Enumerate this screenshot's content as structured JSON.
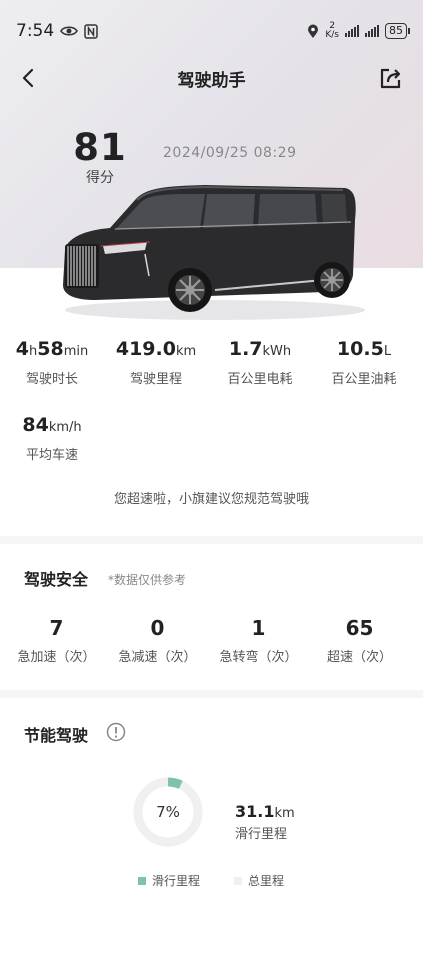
{
  "status": {
    "time": "7:54",
    "network_top": "2",
    "network_bottom": "K/s",
    "battery": "85"
  },
  "nav": {
    "title": "驾驶助手"
  },
  "score": {
    "value": "81",
    "label": "得分"
  },
  "trip": {
    "datetime": "2024/09/25  08:29"
  },
  "stats": [
    {
      "value": "4",
      "unit1": "h",
      "value2": "58",
      "unit2": "min",
      "label": "驾驶时长"
    },
    {
      "value": "419.0",
      "unit": "km",
      "label": "驾驶里程"
    },
    {
      "value": "1.7",
      "unit": "kWh",
      "label": "百公里电耗"
    },
    {
      "value": "10.5",
      "unit": "L",
      "label": "百公里油耗"
    }
  ],
  "avg_speed": {
    "value": "84",
    "unit": "km/h",
    "label": "平均车速"
  },
  "notice": "您超速啦，小旗建议您规范驾驶哦",
  "safety": {
    "title": "驾驶安全",
    "note": "*数据仅供参考",
    "items": [
      {
        "value": "7",
        "label": "急加速（次）"
      },
      {
        "value": "0",
        "label": "急减速（次）"
      },
      {
        "value": "1",
        "label": "急转弯（次）"
      },
      {
        "value": "65",
        "label": "超速（次）"
      }
    ]
  },
  "eco": {
    "title": "节能驾驶",
    "glide_percent": 7,
    "percent_text": "7%",
    "glide_value": "31.1",
    "glide_unit": "km",
    "glide_label": "滑行里程",
    "legend_glide": "滑行里程",
    "legend_total": "总里程"
  },
  "colors": {
    "accent": "#7fc2a6",
    "track": "#f0f0f2"
  },
  "icons": [
    "back-arrow-icon",
    "share-icon",
    "info-icon",
    "location-icon",
    "eye-icon",
    "nfc-icon"
  ]
}
